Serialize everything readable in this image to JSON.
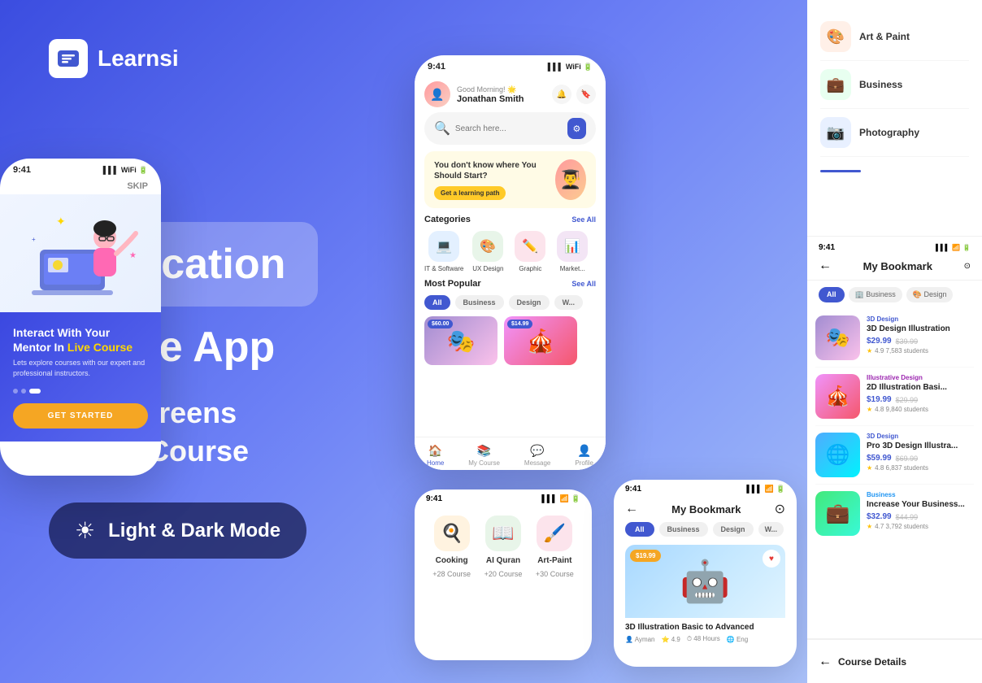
{
  "brand": {
    "name": "Learnsi",
    "tagline": "Education Mobile App"
  },
  "hero": {
    "title_line1": "Education",
    "title_line2": "Mobile App",
    "screens": "150+ Screens",
    "course": "Online Course",
    "mode_label": "Light & Dark Mode"
  },
  "status_bar": {
    "time": "9:41",
    "signal": "▌▌▌",
    "wifi": "WiFi",
    "battery": "🔋"
  },
  "onboarding": {
    "skip": "SKIP",
    "title": "Interact With Your Mentor In",
    "highlight": "Live Course",
    "description": "Lets explore courses with our expert and professional instructors.",
    "cta": "GET STARTED"
  },
  "home": {
    "greeting": "Good Morning! 🌟",
    "user_name": "Jonathan Smith",
    "search_placeholder": "Search here...",
    "banner_title": "You don't know where You Should Start?",
    "banner_cta": "Get a learning path",
    "categories_label": "Categories",
    "see_all": "See All",
    "most_popular": "Most Popular",
    "categories": [
      {
        "name": "IT & Software",
        "emoji": "💻",
        "color": "#e3f0ff"
      },
      {
        "name": "UX Design",
        "emoji": "🎨",
        "color": "#e8f5e9"
      },
      {
        "name": "Graphic",
        "emoji": "✏️",
        "color": "#fce4ec"
      },
      {
        "name": "Market...",
        "emoji": "📊",
        "color": "#f3e5f5"
      }
    ],
    "filter_tabs": [
      "All",
      "Business",
      "Design",
      "W..."
    ],
    "nav_items": [
      "Home",
      "My Course",
      "Message",
      "Profile"
    ]
  },
  "bookmark": {
    "title": "My Bookmark",
    "filters": [
      "All",
      "Business",
      "Design",
      "W..."
    ],
    "courses": [
      {
        "badge": "3D Design",
        "name": "3D Design Illustration",
        "price": "$29.99",
        "original_price": "$39.99",
        "rating": "4.9",
        "students": "7,583 students",
        "emoji": "🎭",
        "bg": "#f0e8ff"
      },
      {
        "badge": "Illustrative Design",
        "name": "2D Illustration Basi...",
        "price": "$19.99",
        "original_price": "$29.99",
        "rating": "4.8",
        "students": "9,840 students",
        "emoji": "🎪",
        "bg": "#ffe8f0"
      },
      {
        "badge": "3D Design",
        "name": "Pro 3D Design Illustra...",
        "price": "$59.99",
        "original_price": "$69.99",
        "rating": "4.8",
        "students": "6,837 students",
        "emoji": "🌐",
        "bg": "#e8f0ff"
      },
      {
        "badge": "Business",
        "name": "Increase Your Business...",
        "price": "$32.99",
        "original_price": "$44.99",
        "rating": "4.7",
        "students": "3,792 students",
        "emoji": "💼",
        "bg": "#e8fff0"
      }
    ]
  },
  "right_categories": [
    {
      "name": "Art & Paint",
      "emoji": "🎨",
      "color": "#fff0e8"
    },
    {
      "name": "Business",
      "emoji": "💼",
      "color": "#e8fff0"
    },
    {
      "name": "Photography",
      "emoji": "📷",
      "color": "#e8f0ff"
    }
  ],
  "bottom_categories": [
    {
      "name": "Cooking",
      "count": "+28 Course",
      "emoji": "🍳",
      "color": "#fff3e0"
    },
    {
      "name": "AI Quran",
      "count": "+20 Course",
      "emoji": "📖",
      "color": "#e8f5e9"
    },
    {
      "name": "Art-Paint",
      "count": "+30 Course",
      "emoji": "🖌️",
      "color": "#fce4ec"
    }
  ],
  "bookmark_bottom": {
    "title": "My Bookmark",
    "course_name": "3D Illustration Basic to Advanced",
    "author": "Ayman",
    "rating": "4.9",
    "hours": "48 Hours",
    "lang": "Eng",
    "price_badge": "$19.99"
  },
  "course_details": {
    "title": "Course Details"
  }
}
